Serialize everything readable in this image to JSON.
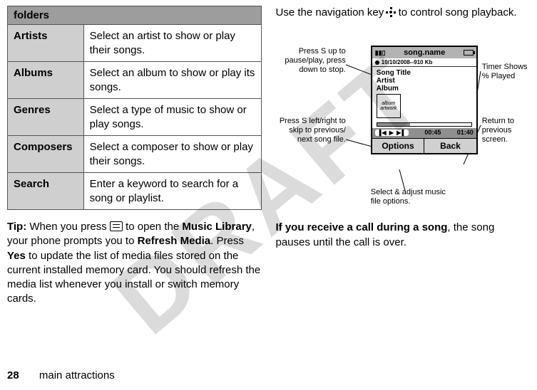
{
  "watermark": "DRAFT",
  "table": {
    "header": "folders",
    "rows": [
      {
        "label": "Artists",
        "desc": "Select an artist to show or play their songs."
      },
      {
        "label": "Albums",
        "desc": "Select an album to show or play its songs."
      },
      {
        "label": "Genres",
        "desc": "Select a type of music to show or play songs."
      },
      {
        "label": "Composers",
        "desc": "Select a composer to show or play their songs."
      },
      {
        "label": "Search",
        "desc": "Enter a keyword to search for a song or playlist."
      }
    ]
  },
  "tip": {
    "lead": "Tip:",
    "part1": " When you press ",
    "part2": " to open the ",
    "bold1": "Music Library",
    "part3": ", your phone prompts you to ",
    "bold2": "Refresh Media",
    "part4": ". Press ",
    "bold3": "Yes",
    "part5": " to update the list of media files stored on the current installed memory card. You should refresh the media list whenever you install or switch memory cards."
  },
  "right_intro": {
    "a": "Use the navigation key ",
    "b": " to control song playback."
  },
  "phone": {
    "title": "song.name",
    "meta": "10/10/2008--910 Kb",
    "song_title": "Song Title",
    "artist": "Artist",
    "album": "Album",
    "artwork": "album artwork",
    "time_elapsed": "00:45",
    "time_total": "01:40",
    "soft_left": "Options",
    "soft_right": "Back"
  },
  "callouts": {
    "c1": "Press S up to pause/play, press down to stop.",
    "c2": "Press S left/right to skip to previous/ next  song file.",
    "c3": "Timer Shows % Played",
    "c4": "Return to previous screen.",
    "c5": "Select & adjust music file options."
  },
  "receive": {
    "bold": "If you receive a call during a song",
    "rest": ", the song pauses until the call is over."
  },
  "footer": {
    "page": "28",
    "section": "main attractions"
  }
}
